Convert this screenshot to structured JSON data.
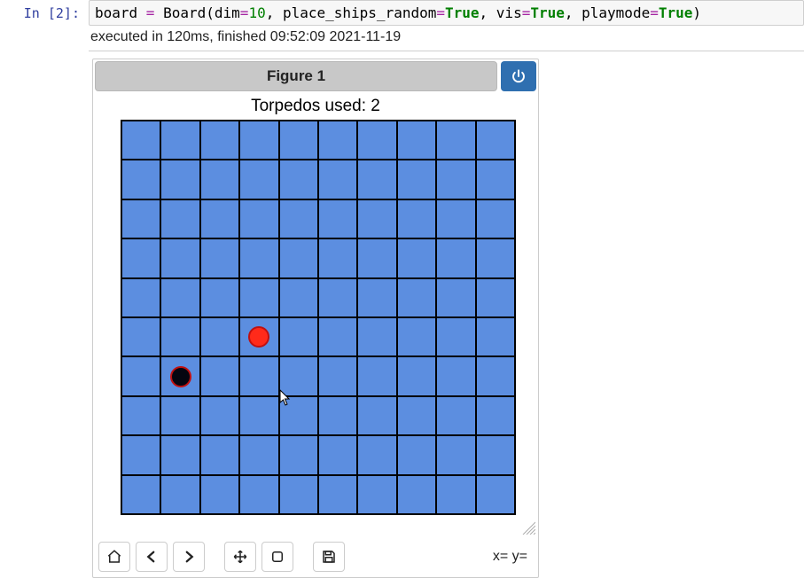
{
  "cell": {
    "prompt_label": "In [2]:",
    "code_tokens": {
      "var": "board",
      "eq": " = ",
      "call": "Board",
      "open": "(",
      "args": [
        {
          "kw": "dim",
          "eq": "=",
          "val": "10",
          "cls": "num"
        },
        {
          "kw": "place_ships_random",
          "eq": "=",
          "val": "True",
          "cls": "bool"
        },
        {
          "kw": "vis",
          "eq": "=",
          "val": "True",
          "cls": "bool"
        },
        {
          "kw": "playmode",
          "eq": "=",
          "val": "True",
          "cls": "bool"
        }
      ],
      "close": ")"
    },
    "exec_status": "executed in 120ms, finished 09:52:09 2021-11-19"
  },
  "figure": {
    "header_title": "Figure 1",
    "plot_title": "Torpedos used: 2",
    "coord_readout": "x= y=",
    "toolbar": {
      "home": "home-icon",
      "back": "back-icon",
      "forward": "forward-icon",
      "pan": "pan-icon",
      "zoom": "zoom-icon",
      "save": "save-icon"
    },
    "power": "power-icon"
  },
  "chart_data": {
    "type": "heatmap",
    "title": "Torpedos used: 2",
    "grid_size": 10,
    "cells_color": "#5c8ee0",
    "shots": [
      {
        "col": 3,
        "row": 5,
        "hit": true,
        "color": "red"
      },
      {
        "col": 1,
        "row": 6,
        "hit": false,
        "color": "black"
      }
    ],
    "xlim": [
      0,
      10
    ],
    "ylim": [
      0,
      10
    ]
  }
}
